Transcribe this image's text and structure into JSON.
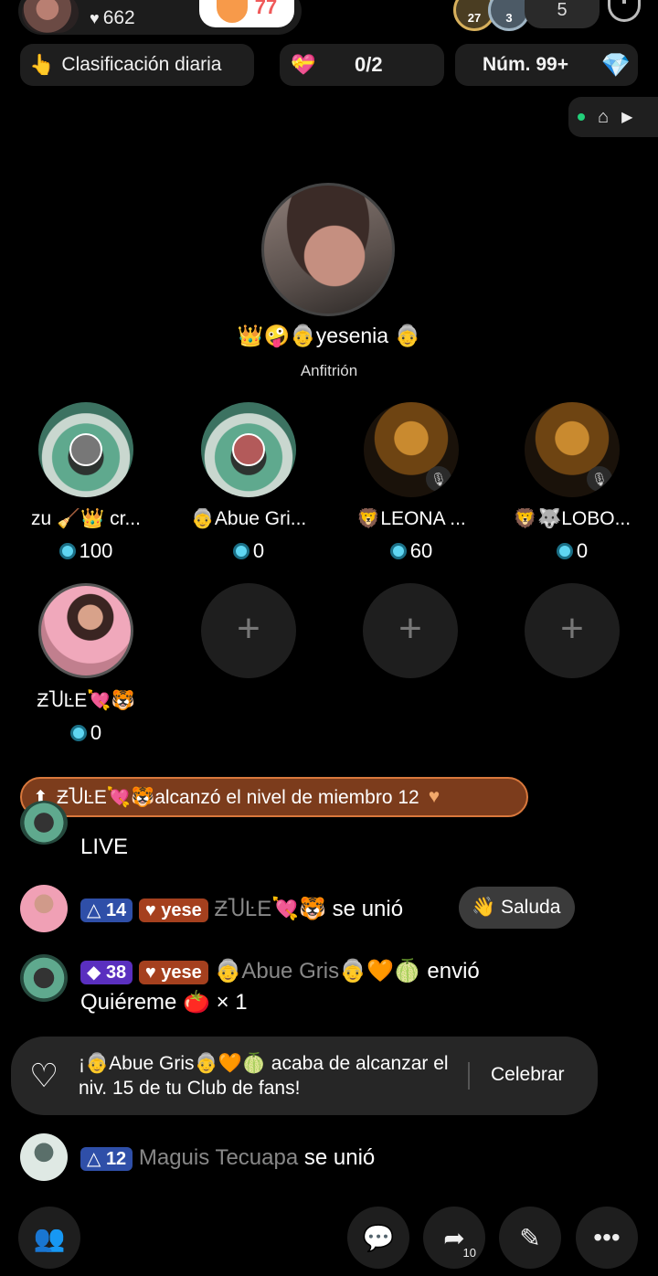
{
  "host_bar": {
    "likes": "662",
    "follow_count": "77"
  },
  "viewers": {
    "badge_1": "27",
    "badge_2": "3",
    "count": "5"
  },
  "chips": {
    "daily_ranking": "Clasificación diaria",
    "goal_progress": "0/2",
    "rank": "Núm. 99+"
  },
  "host": {
    "name": "👑🤪👵yesenia 👵",
    "role": "Anfitrión"
  },
  "seats": [
    {
      "name": "zu 🧹👑 cr...",
      "score": "100"
    },
    {
      "name": "👵Abue Gri...",
      "score": "0"
    },
    {
      "name": "🦁LEONA ...",
      "score": "60"
    },
    {
      "name": "🦁🐺LOBO...",
      "score": "0"
    },
    {
      "name": "ƵႮĿЕ💘🐯",
      "score": "0"
    }
  ],
  "level_banner": {
    "text": "ƵႮĿЕ💘🐯alcanzó el nivel de miembro 12"
  },
  "chat": {
    "partial_line": "LIVE",
    "join1": {
      "level": "14",
      "club": "yese",
      "name": "ƵႮĿЕ💘🐯",
      "action": "se unió",
      "greet": "Saluda"
    },
    "gift": {
      "level": "38",
      "club": "yese",
      "name": "👵Abue Gris👵🧡🍈",
      "action": "envió",
      "gift_line": "Quiéreme 🍅 × 1"
    },
    "fan_toast": {
      "text": "¡👵Abue Gris👵🧡🍈 acaba de alcanzar el niv. 15 de tu Club de fans!",
      "button": "Celebrar"
    },
    "join2": {
      "level": "12",
      "name": "Maguis Tecuapa",
      "action": "se unió"
    }
  },
  "bottom": {
    "share_count": "10"
  }
}
